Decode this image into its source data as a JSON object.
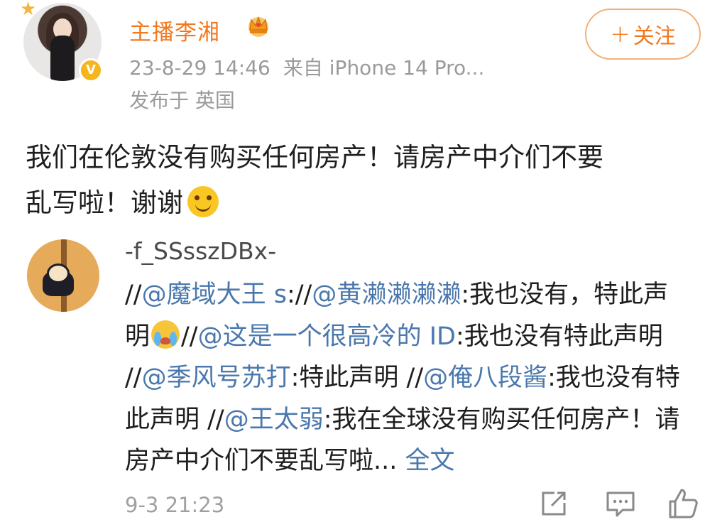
{
  "post": {
    "author_name": "主播李湘",
    "timestamp": "23-8-29 14:46",
    "source": "来自 iPhone 14 Pro...",
    "location": "发布于 英国",
    "follow_label": "关注",
    "follow_plus": "+",
    "text_line1": "我们在伦敦没有购买任何房产！请房产中介们不要",
    "text_line2": "乱写啦！谢谢",
    "icons": {
      "crown": "crown-icon",
      "verified": "verified-badge-icon",
      "smile_emoji": "smile-emoji"
    }
  },
  "repost": {
    "username": "-f_SSsszDBx-",
    "segments": [
      {
        "type": "text",
        "value": "//"
      },
      {
        "type": "mention",
        "value": "@魔域大王 s"
      },
      {
        "type": "text",
        "value": "://"
      },
      {
        "type": "mention",
        "value": "@黄濑濑濑濑"
      },
      {
        "type": "text",
        "value": ":我也没有，特此声明"
      },
      {
        "type": "emoji",
        "value": "cry-emoji"
      },
      {
        "type": "text",
        "value": "//"
      },
      {
        "type": "mention",
        "value": "@这是一个很高冷的 ID"
      },
      {
        "type": "text",
        "value": ":我也没有特此声明 //"
      },
      {
        "type": "mention",
        "value": "@季风号苏打"
      },
      {
        "type": "text",
        "value": ":特此声明 //"
      },
      {
        "type": "mention",
        "value": "@俺八段酱"
      },
      {
        "type": "text",
        "value": ":我也没有特此声明 //"
      },
      {
        "type": "mention",
        "value": "@王太弱"
      },
      {
        "type": "text",
        "value": ":我在全球没有购买任何房产！请房产中介们不要乱写啦... "
      }
    ],
    "full_text_label": "全文",
    "time": "9-3 21:23"
  },
  "actions": {
    "share": "share-icon",
    "comment": "comment-icon",
    "like": "like-icon"
  },
  "colors": {
    "author_name": "#f2781e",
    "follow_border": "#f0b27a",
    "mention": "#4a78ad",
    "meta_gray": "#9a9a9a"
  }
}
